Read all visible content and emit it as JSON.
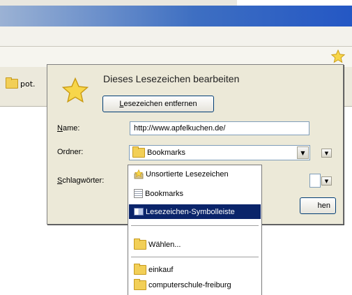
{
  "dialog": {
    "title": "Dieses Lesezeichen bearbeiten",
    "remove_button": {
      "mnemonic": "L",
      "rest": "esezeichen entfernen"
    },
    "name_label": {
      "mnemonic": "N",
      "rest": "ame:"
    },
    "name_value": "http://www.apfelkuchen.de/",
    "folder_label": "Ordner:",
    "folder_value": "Bookmarks",
    "tags_label": {
      "mnemonic": "S",
      "rest": "chlagwörter:"
    },
    "done_button_partial": "hen"
  },
  "tab": {
    "label": "pot."
  },
  "folder_dropdown": {
    "items": [
      {
        "label": "Unsortierte Lesezeichen",
        "icon": "unsorted-bookmarks-icon"
      },
      {
        "label": "Bookmarks",
        "icon": "bookmarks-menu-icon"
      },
      {
        "label": "Lesezeichen-Symbolleiste",
        "icon": "bookmarks-toolbar-icon",
        "selected": true
      },
      {
        "label": "Wählen...",
        "icon": "folder-icon"
      },
      {
        "label": "einkauf",
        "icon": "folder-icon"
      },
      {
        "label": "computerschule-freiburg",
        "icon": "folder-icon"
      }
    ]
  },
  "colors": {
    "dialog_bg": "#ece9d8",
    "selection": "#0a246a",
    "titlebar": "#2457c4",
    "star": "#f7d64a"
  }
}
